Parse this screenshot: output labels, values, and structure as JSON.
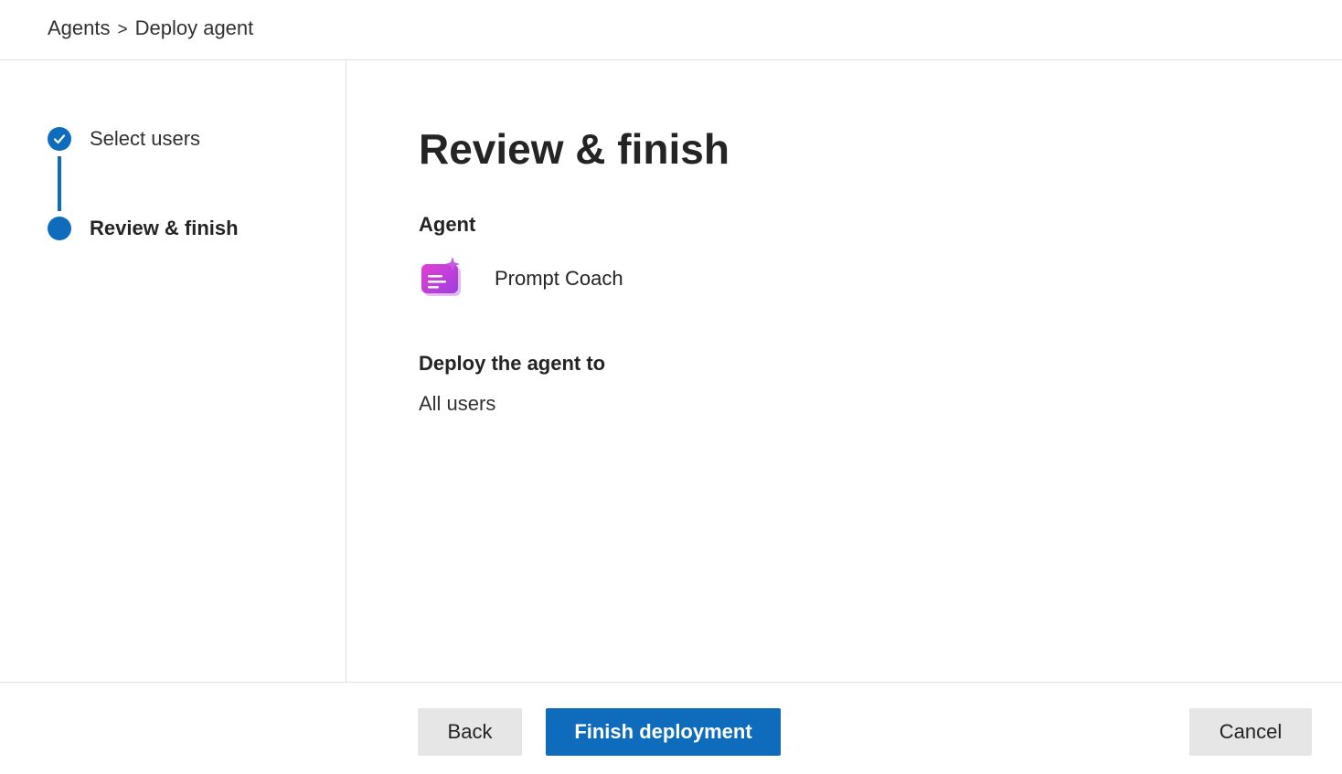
{
  "breadcrumb": {
    "parent": "Agents",
    "separator": ">",
    "current": "Deploy agent"
  },
  "steps": [
    {
      "label": "Select users",
      "status": "completed"
    },
    {
      "label": "Review & finish",
      "status": "current"
    }
  ],
  "main": {
    "title": "Review & finish",
    "agent_section_label": "Agent",
    "agent": {
      "name": "Prompt Coach",
      "icon": "prompt-coach-agent-icon"
    },
    "deploy_section_label": "Deploy the agent to",
    "deploy_value": "All users"
  },
  "footer": {
    "back_label": "Back",
    "finish_label": "Finish deployment",
    "cancel_label": "Cancel"
  },
  "colors": {
    "accent": "#0f6cbd",
    "secondary_button": "#e6e6e6",
    "divider": "#e1e1e1"
  }
}
